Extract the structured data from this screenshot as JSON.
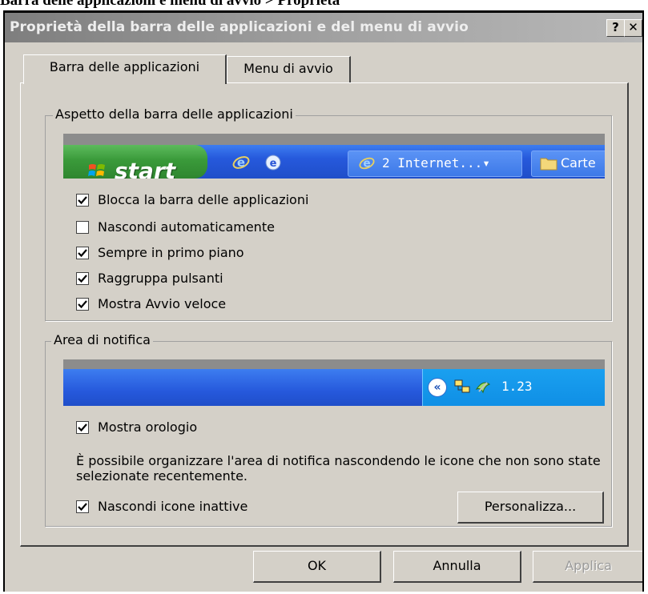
{
  "caption": "Barra delle applicazioni e menu di avvio > Proprietà",
  "window": {
    "title": "Proprietà della barra delle applicazioni e del menu di avvio",
    "help_label": "?",
    "close_label": "✕"
  },
  "tabs": [
    {
      "label": "Barra delle applicazioni",
      "active": true
    },
    {
      "label": "Menu di avvio",
      "active": false
    }
  ],
  "taskbar_group": {
    "title": "Aspetto della barra delle applicazioni",
    "preview": {
      "start_label": "start",
      "task_buttons": [
        "2 Internet...▾",
        "Carte"
      ]
    },
    "checkboxes": [
      {
        "label": "Blocca la barra delle applicazioni",
        "checked": true
      },
      {
        "label": "Nascondi automaticamente",
        "checked": false
      },
      {
        "label": "Sempre in primo piano",
        "checked": true
      },
      {
        "label": "Raggruppa pulsanti",
        "checked": true
      },
      {
        "label": "Mostra Avvio veloce",
        "checked": true
      }
    ]
  },
  "notify_group": {
    "title": "Area di notifica",
    "preview": {
      "chevron": "«",
      "clock": "1.23"
    },
    "show_clock": {
      "label": "Mostra orologio",
      "checked": true
    },
    "description": "È possibile organizzare l'area di notifica nascondendo le icone che non sono state selezionate recentemente.",
    "hide_inactive": {
      "label": "Nascondi icone inattive",
      "checked": true
    },
    "customize_label": "Personalizza..."
  },
  "footer": {
    "ok_label": "OK",
    "cancel_label": "Annulla",
    "apply_label": "Applica"
  },
  "colors": {
    "dialog_face": "#d4d0c8",
    "taskbar_blue": "#2a56d6",
    "start_green": "#3a9a3a",
    "tray_blue": "#0f8fe5"
  }
}
